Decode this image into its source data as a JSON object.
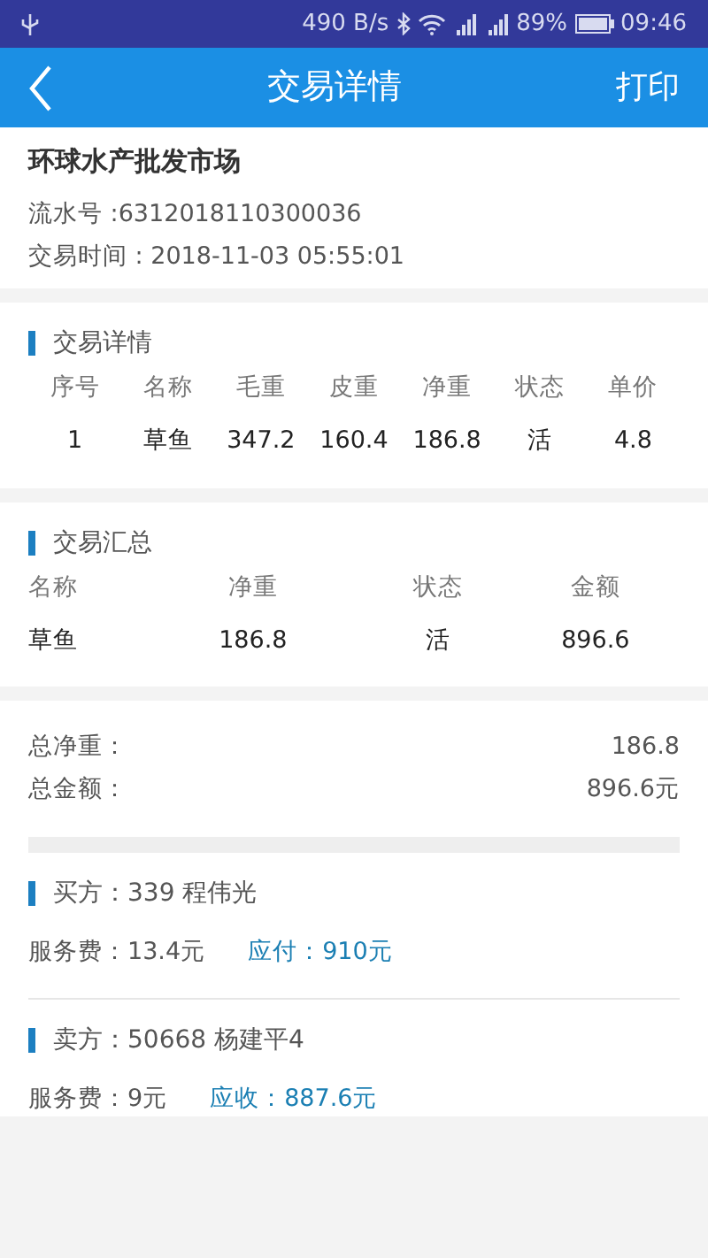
{
  "status_bar": {
    "net_speed": "490 B/s",
    "battery": "89%",
    "time": "09:46"
  },
  "header": {
    "title": "交易详情",
    "action": "打印"
  },
  "market": {
    "name": "环球水产批发市场",
    "serial": "流水号 :6312018110300036",
    "time": "交易时间 : 2018-11-03 05:55:01"
  },
  "details": {
    "title": "交易详情",
    "columns": [
      "序号",
      "名称",
      "毛重",
      "皮重",
      "净重",
      "状态",
      "单价"
    ],
    "rows": [
      [
        "1",
        "草鱼",
        "347.2",
        "160.4",
        "186.8",
        "活",
        "4.8"
      ]
    ]
  },
  "summary": {
    "title": "交易汇总",
    "columns": [
      "名称",
      "净重",
      "状态",
      "金额"
    ],
    "rows": [
      [
        "草鱼",
        "186.8",
        "活",
        "896.6"
      ]
    ]
  },
  "totals": [
    {
      "label": "总净重：",
      "value": "186.8"
    },
    {
      "label": "总金额：",
      "value": "896.6元"
    }
  ],
  "parties": [
    {
      "title": "买方：339  程伟光",
      "fee": "服务费：13.4元",
      "due": "应付：910元"
    },
    {
      "title": "卖方：50668  杨建平4",
      "fee": "服务费：9元",
      "due": "应收：887.6元"
    }
  ]
}
